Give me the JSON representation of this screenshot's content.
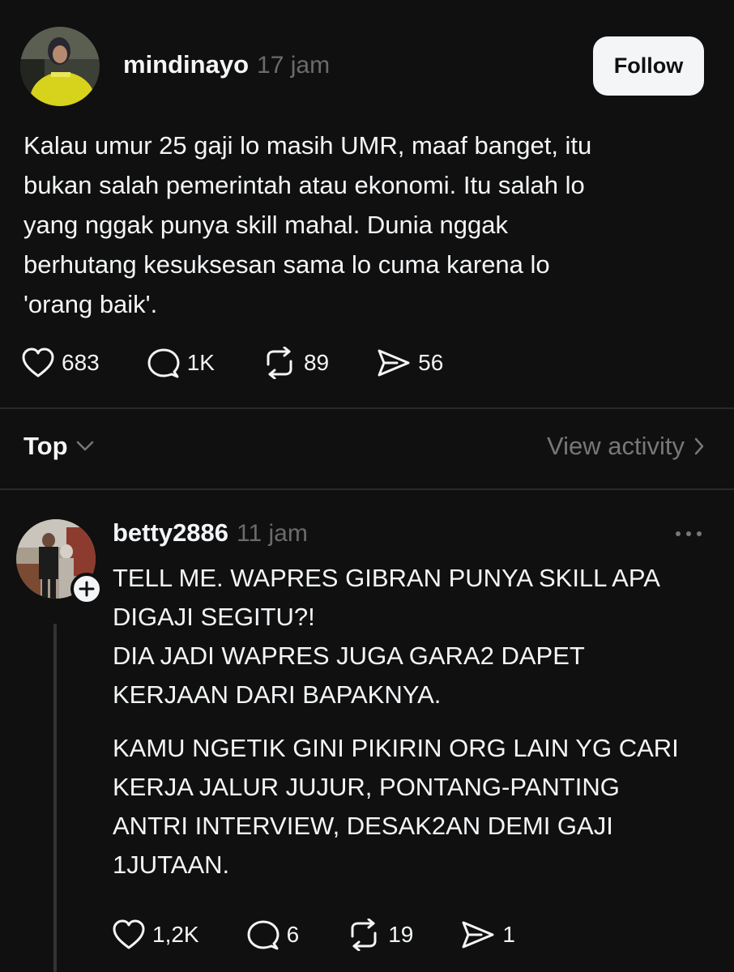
{
  "post": {
    "username": "mindinayo",
    "time": "17 jam",
    "follow_label": "Follow",
    "text_lines": [
      "Kalau umur 25 gaji lo masih UMR, maaf banget, itu",
      "bukan salah pemerintah atau ekonomi. Itu salah lo",
      "yang nggak punya skill mahal. Dunia nggak",
      "berhutang kesuksesan sama lo cuma karena lo",
      "'orang baik'."
    ],
    "likes": "683",
    "comments": "1K",
    "reposts": "89",
    "shares": "56"
  },
  "replies_section": {
    "sort_label": "Top",
    "view_activity_label": "View activity"
  },
  "reply": {
    "username": "betty2886",
    "time": "11 jam",
    "paragraph1": [
      "TELL ME. WAPRES GIBRAN PUNYA SKILL APA",
      "DIGAJI SEGITU?!",
      "DIA JADI WAPRES JUGA GARA2 DAPET",
      "KERJAAN DARI BAPAKNYA."
    ],
    "paragraph2": [
      "KAMU NGETIK GINI PIKIRIN ORG LAIN YG CARI",
      "KERJA JALUR JUJUR, PONTANG-PANTING",
      "ANTRI INTERVIEW, DESAK2AN DEMI GAJI",
      "1JUTAAN."
    ],
    "likes": "1,2K",
    "comments": "6",
    "reposts": "19",
    "shares": "1"
  },
  "icons": {
    "like": "heart-icon",
    "comment": "speech-bubble-icon",
    "repost": "repost-arrows-icon",
    "share": "paper-plane-icon",
    "sort": "chevron-down-icon",
    "activity": "chevron-right-icon",
    "more": "ellipsis-icon",
    "follow_badge": "plus-icon"
  },
  "colors": {
    "background": "#101010",
    "text_primary": "#f3f5f7",
    "text_secondary": "#6b6b6b",
    "divider": "#2a2a2a",
    "follow_button_bg": "#f3f5f7"
  }
}
